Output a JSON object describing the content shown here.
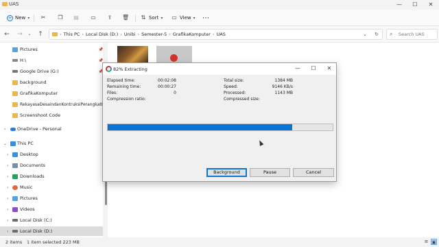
{
  "window": {
    "title": "UAS",
    "controls": [
      "—",
      "☐",
      "✕"
    ]
  },
  "commandbar": {
    "new_label": "New",
    "sort_label": "Sort",
    "view_label": "View",
    "more_label": "⋯"
  },
  "address": {
    "crumbs": [
      "This PC",
      "Local Disk (D:)",
      "Unibi",
      "Semester-5",
      "GrafikaKomputer",
      "UAS"
    ],
    "search_placeholder": "Search UAS"
  },
  "sidebar": {
    "items": [
      {
        "label": "Pictures",
        "pinned": true
      },
      {
        "label": "H:\\",
        "pinned": true
      },
      {
        "label": "Google Drive (G:)",
        "pinned": true
      },
      {
        "label": "background"
      },
      {
        "label": "GrafikaKomputer"
      },
      {
        "label": "RekayasaDesaindanKontruksiPerangkatLunak"
      },
      {
        "label": "Screenshoot Code"
      },
      {
        "label": "OneDrive - Personal"
      },
      {
        "label": "This PC"
      },
      {
        "label": "Desktop"
      },
      {
        "label": "Documents"
      },
      {
        "label": "Downloads"
      },
      {
        "label": "Music"
      },
      {
        "label": "Pictures"
      },
      {
        "label": "Videos"
      },
      {
        "label": "Local Disk (C:)"
      },
      {
        "label": "Local Disk (D:)",
        "selected": true
      }
    ]
  },
  "status": {
    "items_count": "2 items",
    "selection": "1 item selected  223 MB"
  },
  "dialog": {
    "title": "82% Extracting",
    "percent": 82,
    "left": [
      {
        "label": "Elapsed time:",
        "value": "00:02:08"
      },
      {
        "label": "Remaining time:",
        "value": "00:00:27"
      },
      {
        "label": "Files:",
        "value": "0"
      },
      {
        "label": "Compression ratio:",
        "value": ""
      }
    ],
    "right": [
      {
        "label": "Total size:",
        "value": "1384 MB"
      },
      {
        "label": "Speed:",
        "value": "9146 KB/s"
      },
      {
        "label": "Processed:",
        "value": "1143 MB"
      },
      {
        "label": "Compressed size:",
        "value": ""
      }
    ],
    "buttons": {
      "background": "Background",
      "pause": "Pause",
      "cancel": "Cancel"
    }
  },
  "colors": {
    "accent": "#0a74d9",
    "folder": "#e8b84a"
  }
}
